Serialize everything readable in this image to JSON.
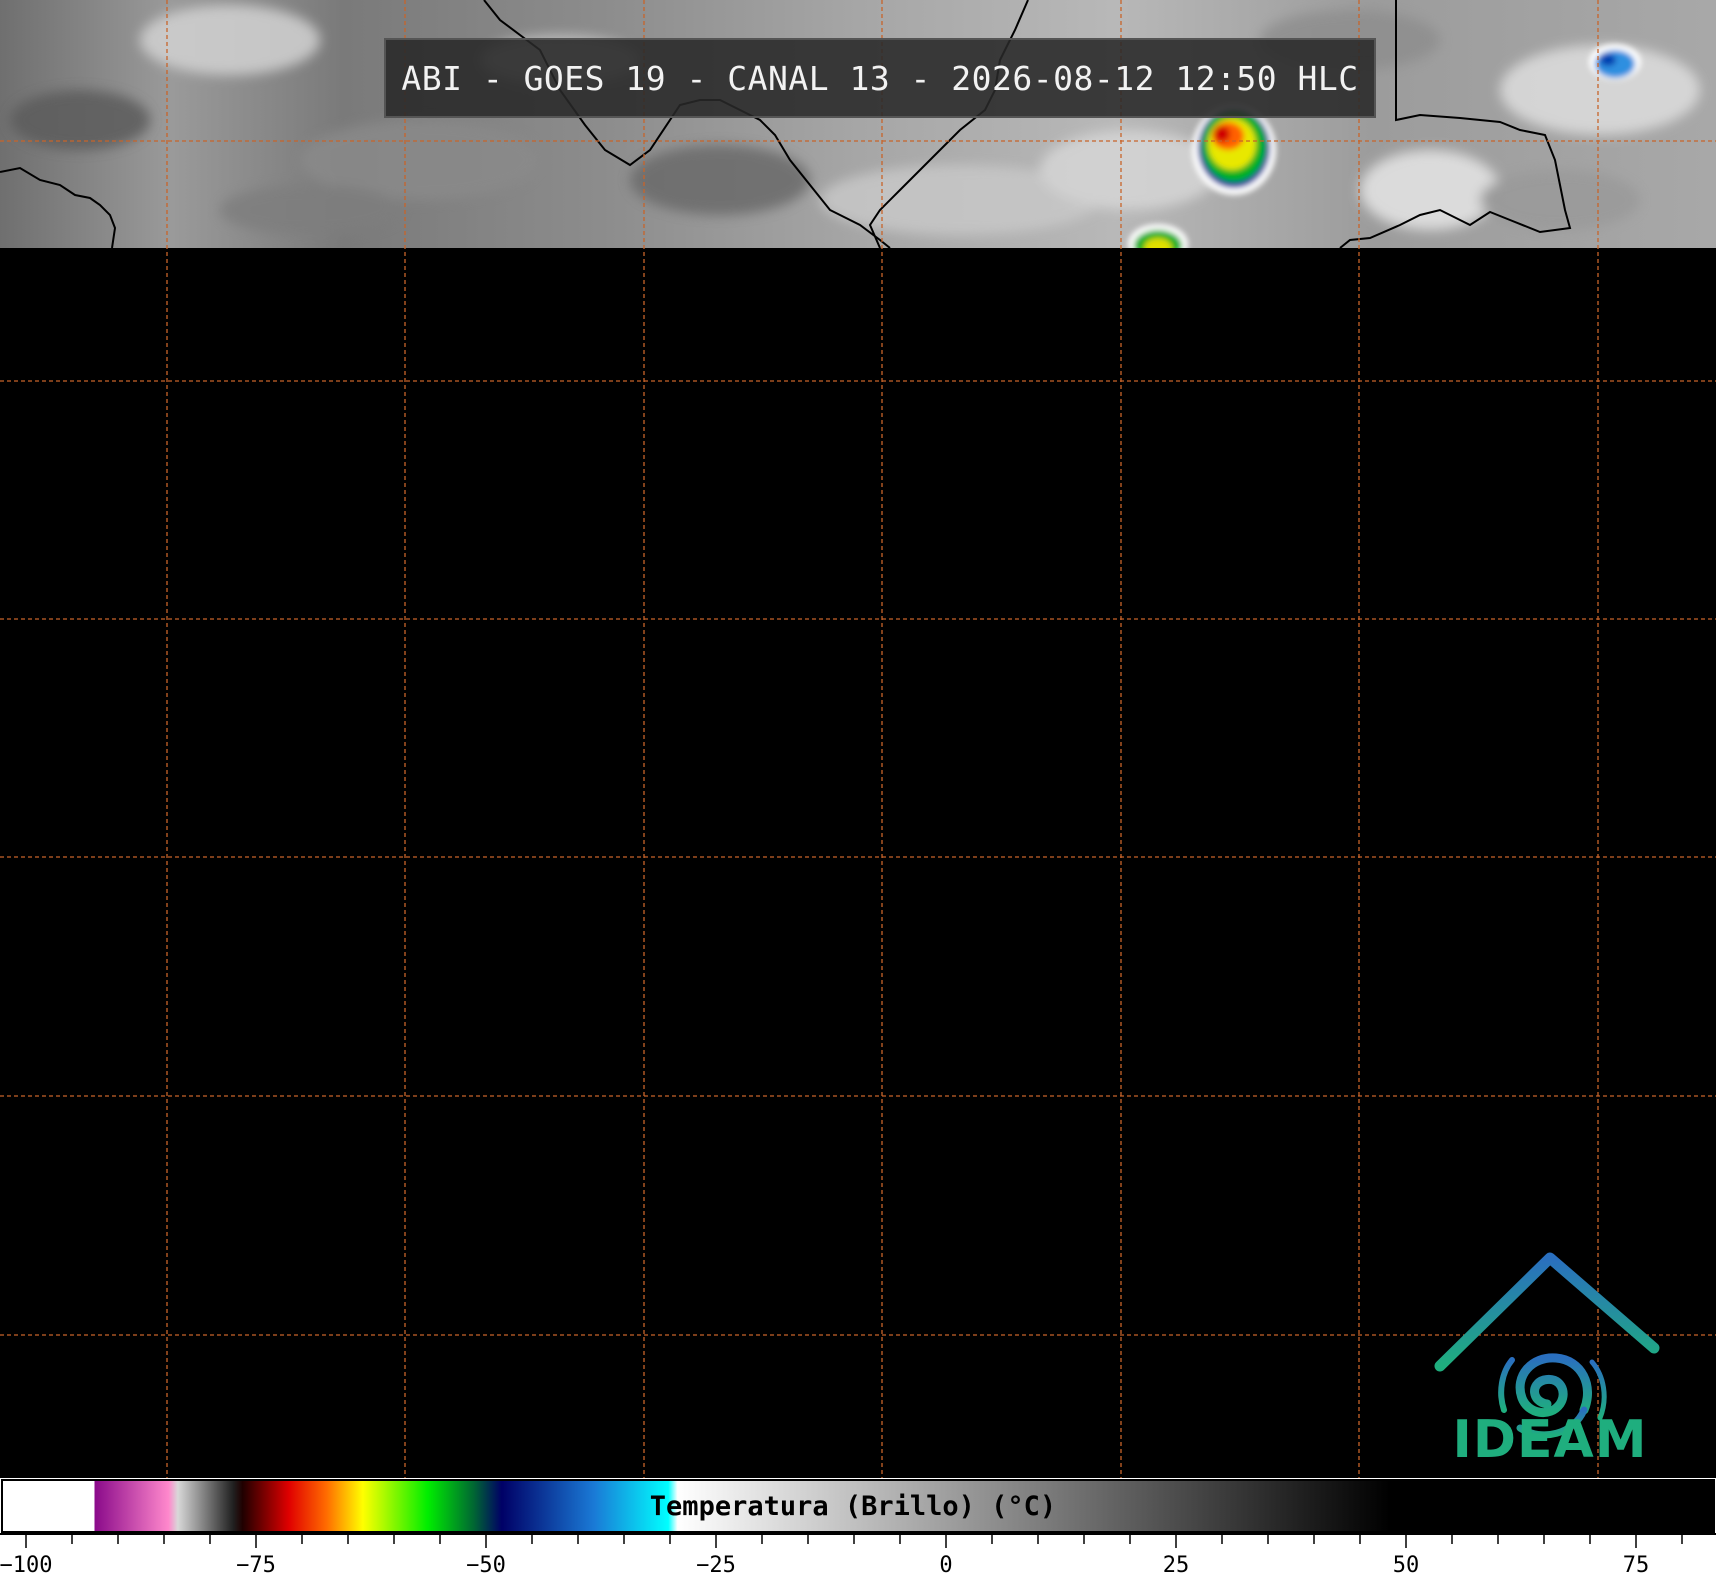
{
  "title": "ABI - GOES 19 - CANAL 13 - 2026-08-12 12:50 HLC",
  "logo_text": "IDEAM",
  "colorbar": {
    "label": "Temperatura (Brillo) (°C)",
    "min": -100,
    "max": 85,
    "ticks": [
      -100,
      -75,
      -50,
      -25,
      0,
      25,
      50,
      75
    ],
    "tick_labels": [
      "−100",
      "−75",
      "−50",
      "−25",
      "0",
      "25",
      "50",
      "75"
    ],
    "minor_step": 5,
    "stops": [
      {
        "t": -100,
        "color": "#ffffff"
      },
      {
        "t": -90,
        "color": "#ffffff"
      },
      {
        "t": -90,
        "color": "#8a0a8a"
      },
      {
        "t": -82,
        "color": "#ff88cc"
      },
      {
        "t": -81,
        "color": "#d8d8d8"
      },
      {
        "t": -75,
        "color": "#202020"
      },
      {
        "t": -74,
        "color": "#200000"
      },
      {
        "t": -69,
        "color": "#e00000"
      },
      {
        "t": -65,
        "color": "#ff6a00"
      },
      {
        "t": -61,
        "color": "#ffff00"
      },
      {
        "t": -54,
        "color": "#00ee00"
      },
      {
        "t": -49,
        "color": "#006633"
      },
      {
        "t": -46,
        "color": "#000066"
      },
      {
        "t": -36,
        "color": "#1a7ad6"
      },
      {
        "t": -28,
        "color": "#00ffff"
      },
      {
        "t": -27,
        "color": "#ffffff"
      },
      {
        "t": 50,
        "color": "#000000"
      },
      {
        "t": 85,
        "color": "#000000"
      }
    ]
  }
}
